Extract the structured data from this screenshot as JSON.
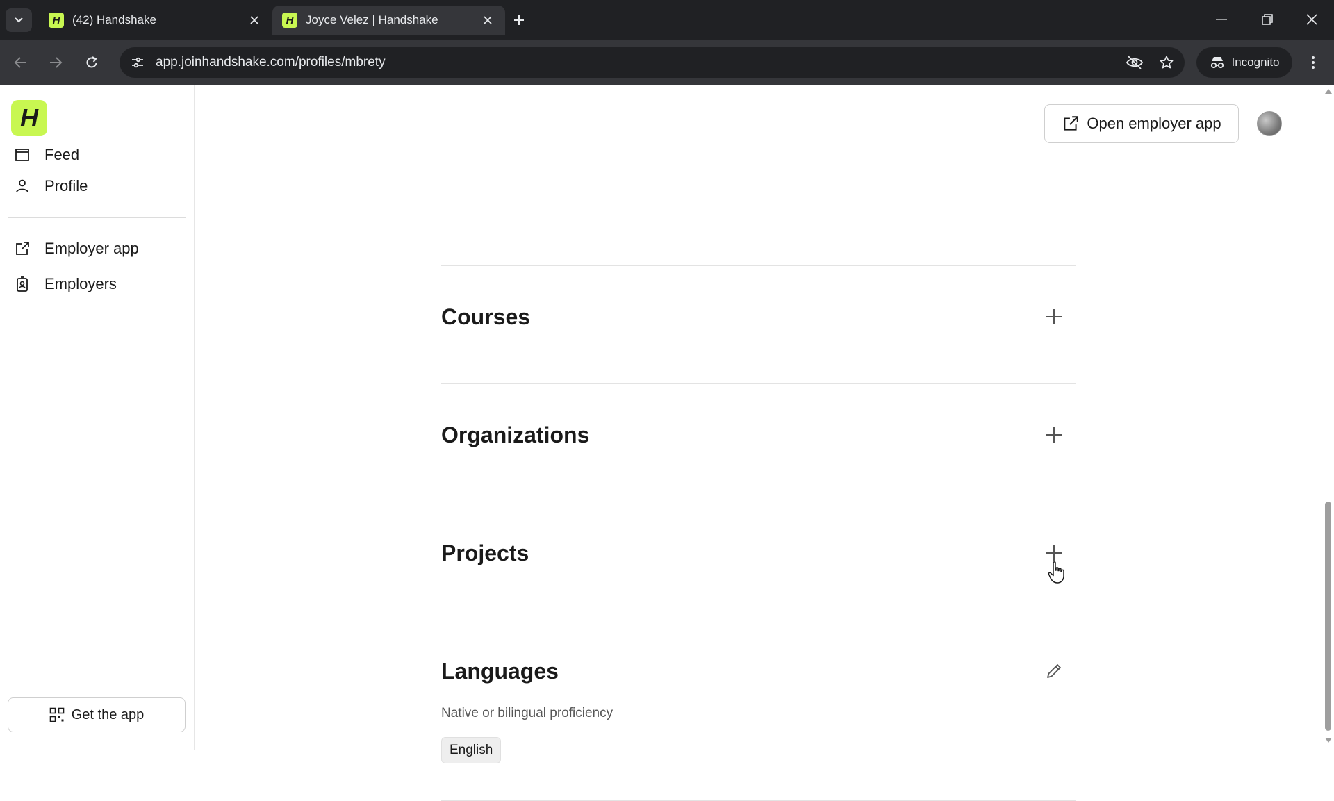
{
  "browser": {
    "tabs": [
      {
        "title": "(42) Handshake",
        "favicon": "H",
        "active": false
      },
      {
        "title": "Joyce Velez | Handshake",
        "favicon": "H",
        "active": true
      }
    ],
    "url": "app.joinhandshake.com/profiles/mbrety",
    "incognito_label": "Incognito"
  },
  "sidebar": {
    "logo": "H",
    "items": [
      {
        "label": "Feed",
        "icon": "feed-icon"
      },
      {
        "label": "Profile",
        "icon": "person-icon"
      },
      {
        "label": "Employer app",
        "icon": "external-link-icon"
      },
      {
        "label": "Employers",
        "icon": "badge-icon"
      }
    ],
    "get_app_label": "Get the app"
  },
  "header": {
    "open_employer_label": "Open employer app"
  },
  "sections": [
    {
      "title": "Courses",
      "action": "plus-icon"
    },
    {
      "title": "Organizations",
      "action": "plus-icon"
    },
    {
      "title": "Projects",
      "action": "plus-icon"
    },
    {
      "title": "Languages",
      "action": "pencil-icon",
      "subtitle": "Native or bilingual proficiency",
      "chips": [
        "English"
      ]
    }
  ],
  "colors": {
    "brand": "#c8f751",
    "chrome_dark": "#202124",
    "chrome_mid": "#35363a"
  }
}
